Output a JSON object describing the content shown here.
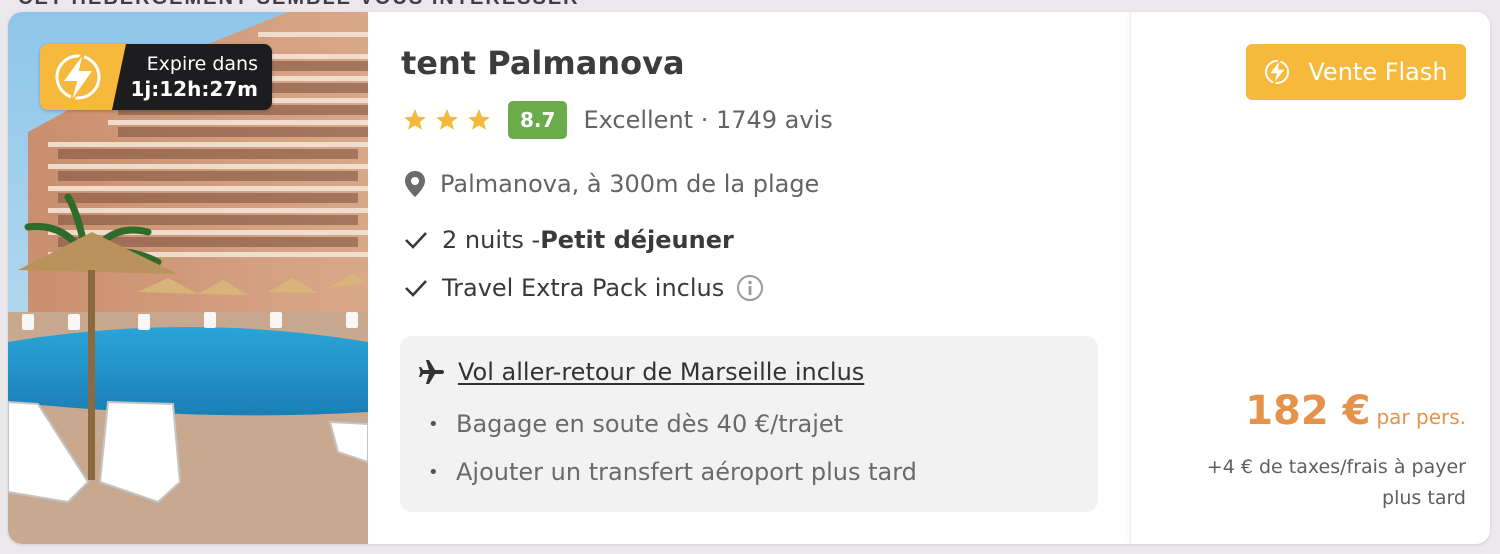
{
  "page_heading_partial": "CET HÉBERGEMENT SEMBLE VOUS INTÉRESSER",
  "colors": {
    "accent_orange": "#f6b93b",
    "price_orange": "#e5934a",
    "score_green": "#6bab4a",
    "timer_dark": "#1d1d1f"
  },
  "photo": {
    "flash_timer": {
      "label": "Expire dans",
      "value": "1j:12h:27m",
      "icon": "lightning-bolt-icon"
    }
  },
  "hotel": {
    "name": "tent Palmanova",
    "stars": 3,
    "score": "8.7",
    "review_text": "Excellent · 1749 avis",
    "location": "Palmanova, à 300m de la plage"
  },
  "features": [
    {
      "prefix": "2 nuits - ",
      "bold": "Petit déjeuner"
    },
    {
      "prefix": "Travel Extra Pack inclus",
      "bold": ""
    }
  ],
  "flight": {
    "title": "Vol aller-retour de Marseille inclus",
    "items": [
      "Bagage en soute dès 40 €/trajet",
      "Ajouter un transfert aéroport plus tard"
    ]
  },
  "pricing": {
    "badge": "Vente Flash",
    "price": "182 €",
    "per": "par pers.",
    "taxes": "+4 € de taxes/frais à payer plus tard"
  }
}
